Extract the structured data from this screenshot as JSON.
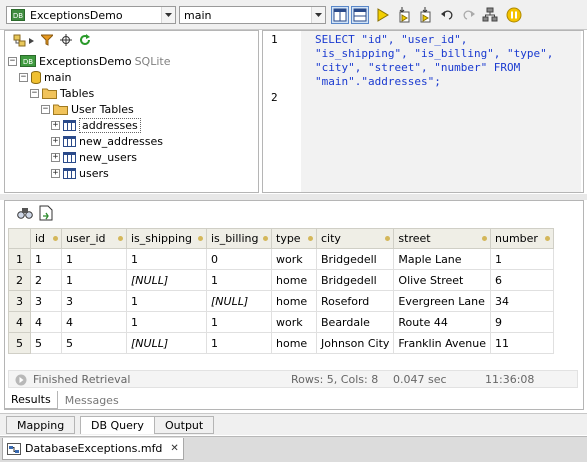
{
  "toolbar": {
    "datasource": "ExceptionsDemo",
    "schema": "main"
  },
  "tree": {
    "root": "ExceptionsDemo",
    "root_kind": "SQLite",
    "schema": "main",
    "tables_folder": "Tables",
    "user_tables_folder": "User Tables",
    "tables": [
      "addresses",
      "new_addresses",
      "new_users",
      "users"
    ]
  },
  "sql": {
    "line_numbers": [
      "1",
      "2"
    ],
    "lines": [
      "SELECT \"id\", \"user_id\",",
      "\"is_shipping\", \"is_billing\", \"type\",",
      "\"city\", \"street\", \"number\" FROM",
      "\"main\".\"addresses\";"
    ]
  },
  "results": {
    "columns": [
      "id",
      "user_id",
      "is_shipping",
      "is_billing",
      "type",
      "city",
      "street",
      "number"
    ],
    "rows": [
      {
        "n": "1",
        "cells": [
          "1",
          "1",
          "1",
          "0",
          "work",
          "Bridgedell",
          "Maple Lane",
          "1"
        ]
      },
      {
        "n": "2",
        "cells": [
          "2",
          "1",
          "[NULL]",
          "1",
          "home",
          "Bridgedell",
          "Olive Street",
          "6"
        ]
      },
      {
        "n": "3",
        "cells": [
          "3",
          "3",
          "1",
          "[NULL]",
          "home",
          "Roseford",
          "Evergreen Lane",
          "34"
        ]
      },
      {
        "n": "4",
        "cells": [
          "4",
          "4",
          "1",
          "1",
          "work",
          "Beardale",
          "Route 44",
          "9"
        ]
      },
      {
        "n": "5",
        "cells": [
          "5",
          "5",
          "[NULL]",
          "1",
          "home",
          "Johnson City",
          "Franklin Avenue",
          "11"
        ]
      }
    ]
  },
  "status": {
    "state": "Finished Retrieval",
    "rows_cols": "Rows: 5, Cols: 8",
    "duration": "0.047 sec",
    "time": "11:36:08"
  },
  "result_tabs": [
    "Results",
    "Messages"
  ],
  "view_tabs": [
    "Mapping",
    "DB Query",
    "Output"
  ],
  "document_tab": "DatabaseExceptions.mfd",
  "colors": {
    "sql_keyword": "#1a3ad0",
    "header_bg": "#efeee6",
    "run_arrow": "#e0c000"
  }
}
